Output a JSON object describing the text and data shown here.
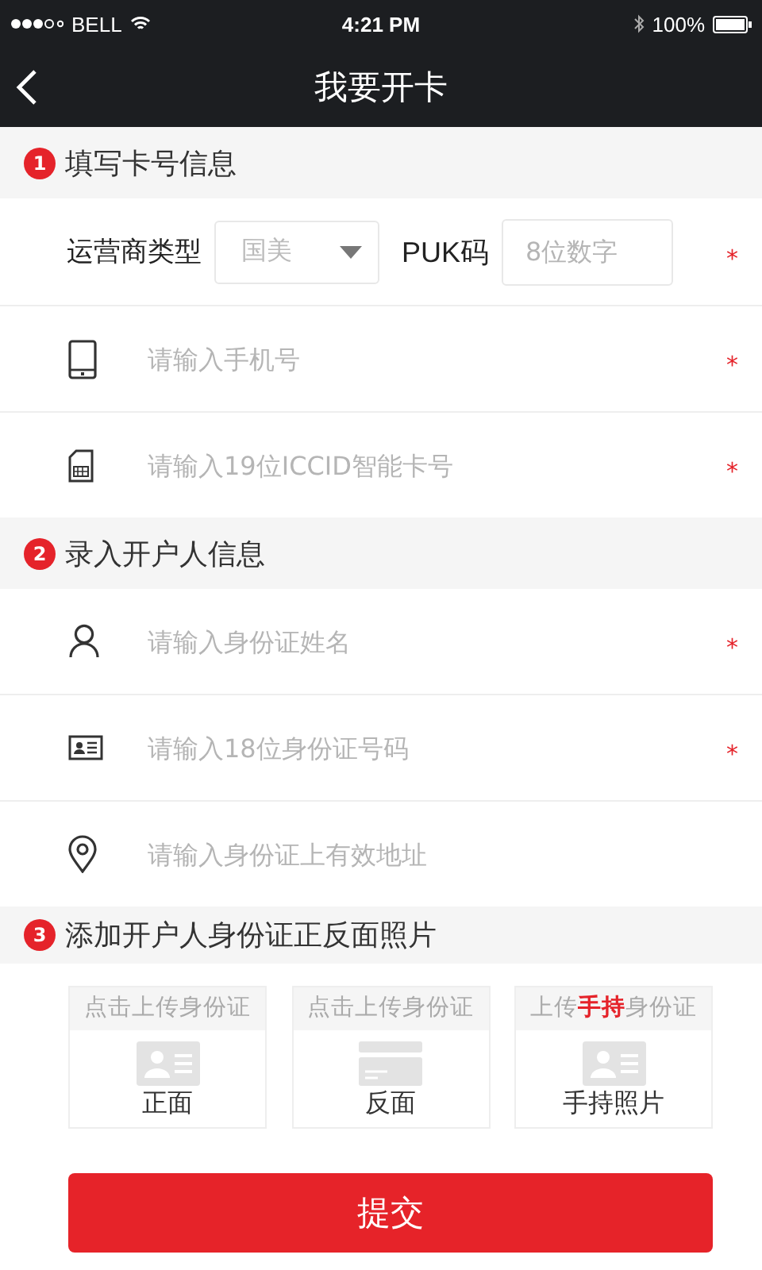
{
  "status_bar": {
    "carrier": "BELL",
    "time": "4:21 PM",
    "battery": "100%"
  },
  "nav": {
    "title": "我要开卡"
  },
  "sections": [
    {
      "number": "1",
      "title": "填写卡号信息",
      "fields": [
        {
          "kind": "carrier",
          "label": "运营商类型",
          "select_value": "国美",
          "puk_label": "PUK码",
          "puk_placeholder": "8位数字",
          "mark": "*"
        },
        {
          "kind": "phone",
          "placeholder": "请输入手机号",
          "mark": "*"
        },
        {
          "kind": "sim",
          "placeholder": "请输入19位ICCID智能卡号",
          "mark": "*"
        }
      ]
    },
    {
      "number": "2",
      "title": "录入开户人信息",
      "fields": [
        {
          "kind": "person",
          "placeholder": "请输入身份证姓名",
          "mark": "*"
        },
        {
          "kind": "idcard",
          "placeholder": "请输入18位身份证号码",
          "mark": "*"
        },
        {
          "kind": "pin",
          "placeholder": "请输入身份证上有效地址"
        }
      ]
    },
    {
      "number": "3",
      "title": "添加开户人身份证正反面照片",
      "uploads": [
        {
          "caption": "点击上传身份证",
          "kind": "front",
          "label": "正面"
        },
        {
          "caption": "点击上传身份证",
          "kind": "back",
          "label": "反面"
        },
        {
          "caption": "上传**手持**身份证",
          "kind": "front",
          "label": "手持照片"
        }
      ]
    }
  ],
  "submit": "提交"
}
